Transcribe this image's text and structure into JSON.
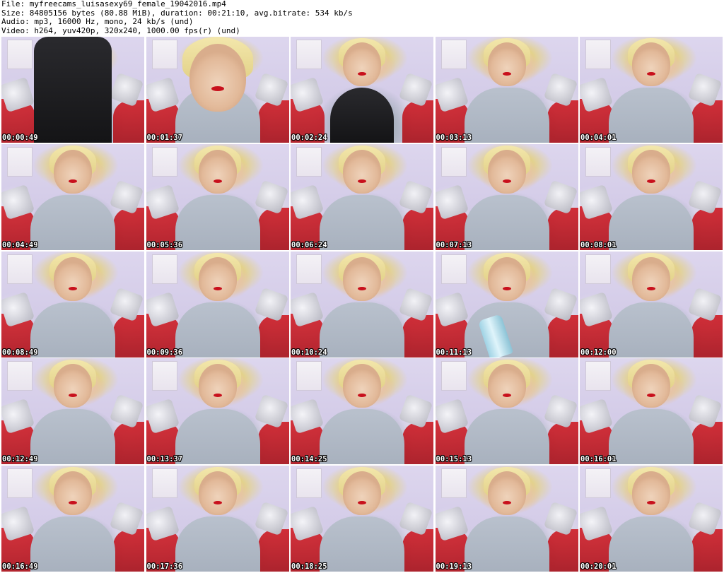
{
  "header": {
    "file_line": "File: myfreecams_luisasexy69_female_19042016.mp4",
    "size_line": "Size: 84805156 bytes (80.88 MiB), duration: 00:21:10, avg.bitrate: 534 kb/s",
    "audio_line": "Audio: mp3, 16000 Hz, mono, 24 kb/s (und)",
    "video_line": "Video: h264, yuv420p, 320x240, 1000.00 fps(r) (und)"
  },
  "thumbnails": [
    {
      "timestamp": "00:00:49"
    },
    {
      "timestamp": "00:01:37"
    },
    {
      "timestamp": "00:02:24"
    },
    {
      "timestamp": "00:03:13"
    },
    {
      "timestamp": "00:04:01"
    },
    {
      "timestamp": "00:04:49"
    },
    {
      "timestamp": "00:05:36"
    },
    {
      "timestamp": "00:06:24"
    },
    {
      "timestamp": "00:07:13"
    },
    {
      "timestamp": "00:08:01"
    },
    {
      "timestamp": "00:08:49"
    },
    {
      "timestamp": "00:09:36"
    },
    {
      "timestamp": "00:10:24"
    },
    {
      "timestamp": "00:11:13"
    },
    {
      "timestamp": "00:12:00"
    },
    {
      "timestamp": "00:12:49"
    },
    {
      "timestamp": "00:13:37"
    },
    {
      "timestamp": "00:14:25"
    },
    {
      "timestamp": "00:15:13"
    },
    {
      "timestamp": "00:16:01"
    },
    {
      "timestamp": "00:16:49"
    },
    {
      "timestamp": "00:17:36"
    },
    {
      "timestamp": "00:18:25"
    },
    {
      "timestamp": "00:19:13"
    },
    {
      "timestamp": "00:20:01"
    }
  ],
  "colors": {
    "background": "#ffffff",
    "header_text": "#000000",
    "timestamp_text": "#ffffff",
    "timestamp_outline": "#000000"
  }
}
